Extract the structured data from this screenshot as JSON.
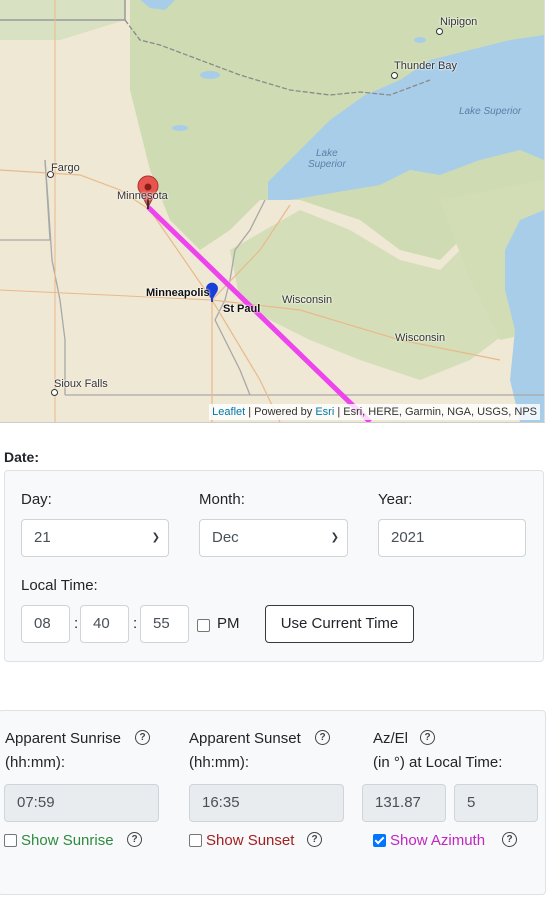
{
  "map": {
    "places": {
      "nipigon": "Nipigon",
      "thunder_bay": "Thunder Bay",
      "lake_superior_east": "Lake Superior",
      "lake_superior_west_line1": "Lake",
      "lake_superior_west_line2": "Superior",
      "fargo": "Fargo",
      "minnesota": "Minnesota",
      "minneapolis": "Minneapolis",
      "st_paul": "St Paul",
      "wisconsin_north": "Wisconsin",
      "wisconsin_south": "Wisconsin",
      "sioux_falls": "Sioux Falls"
    },
    "attribution": {
      "leaflet": "Leaflet",
      "powered_by": " | Powered by ",
      "esri": "Esri",
      "sources": " | Esri, HERE, Garmin, NGA, USGS, NPS"
    },
    "azimuth_line_color": "#ee44ee",
    "observer_marker_color": "#e8554e",
    "sun_marker_color": "#1a3fd8"
  },
  "date": {
    "title": "Date:",
    "day_label": "Day:",
    "day_value": "21",
    "month_label": "Month:",
    "month_value": "Dec",
    "year_label": "Year:",
    "year_value": "2021",
    "local_time_label": "Local Time:",
    "hour": "08",
    "minute": "40",
    "second": "55",
    "time_sep": ":",
    "pm_label": "PM",
    "pm_checked": false,
    "use_current_time": "Use Current Time"
  },
  "results": {
    "sunrise_label": "Apparent Sunrise",
    "sunrise_unit": "(hh:mm):",
    "sunrise_value": "07:59",
    "sunset_label": "Apparent Sunset",
    "sunset_unit": "(hh:mm):",
    "sunset_value": "16:35",
    "azel_label": "Az/El",
    "azel_unit": "(in °) at Local Time:",
    "azimuth_value": "131.87",
    "elevation_value": "5",
    "show_sunrise": "Show Sunrise",
    "show_sunset": "Show Sunset",
    "show_azimuth": "Show Azimuth",
    "help_glyph": "?",
    "colors": {
      "sunrise": "#2e8b3e",
      "sunset": "#a32020",
      "azimuth": "#c026c0"
    }
  }
}
